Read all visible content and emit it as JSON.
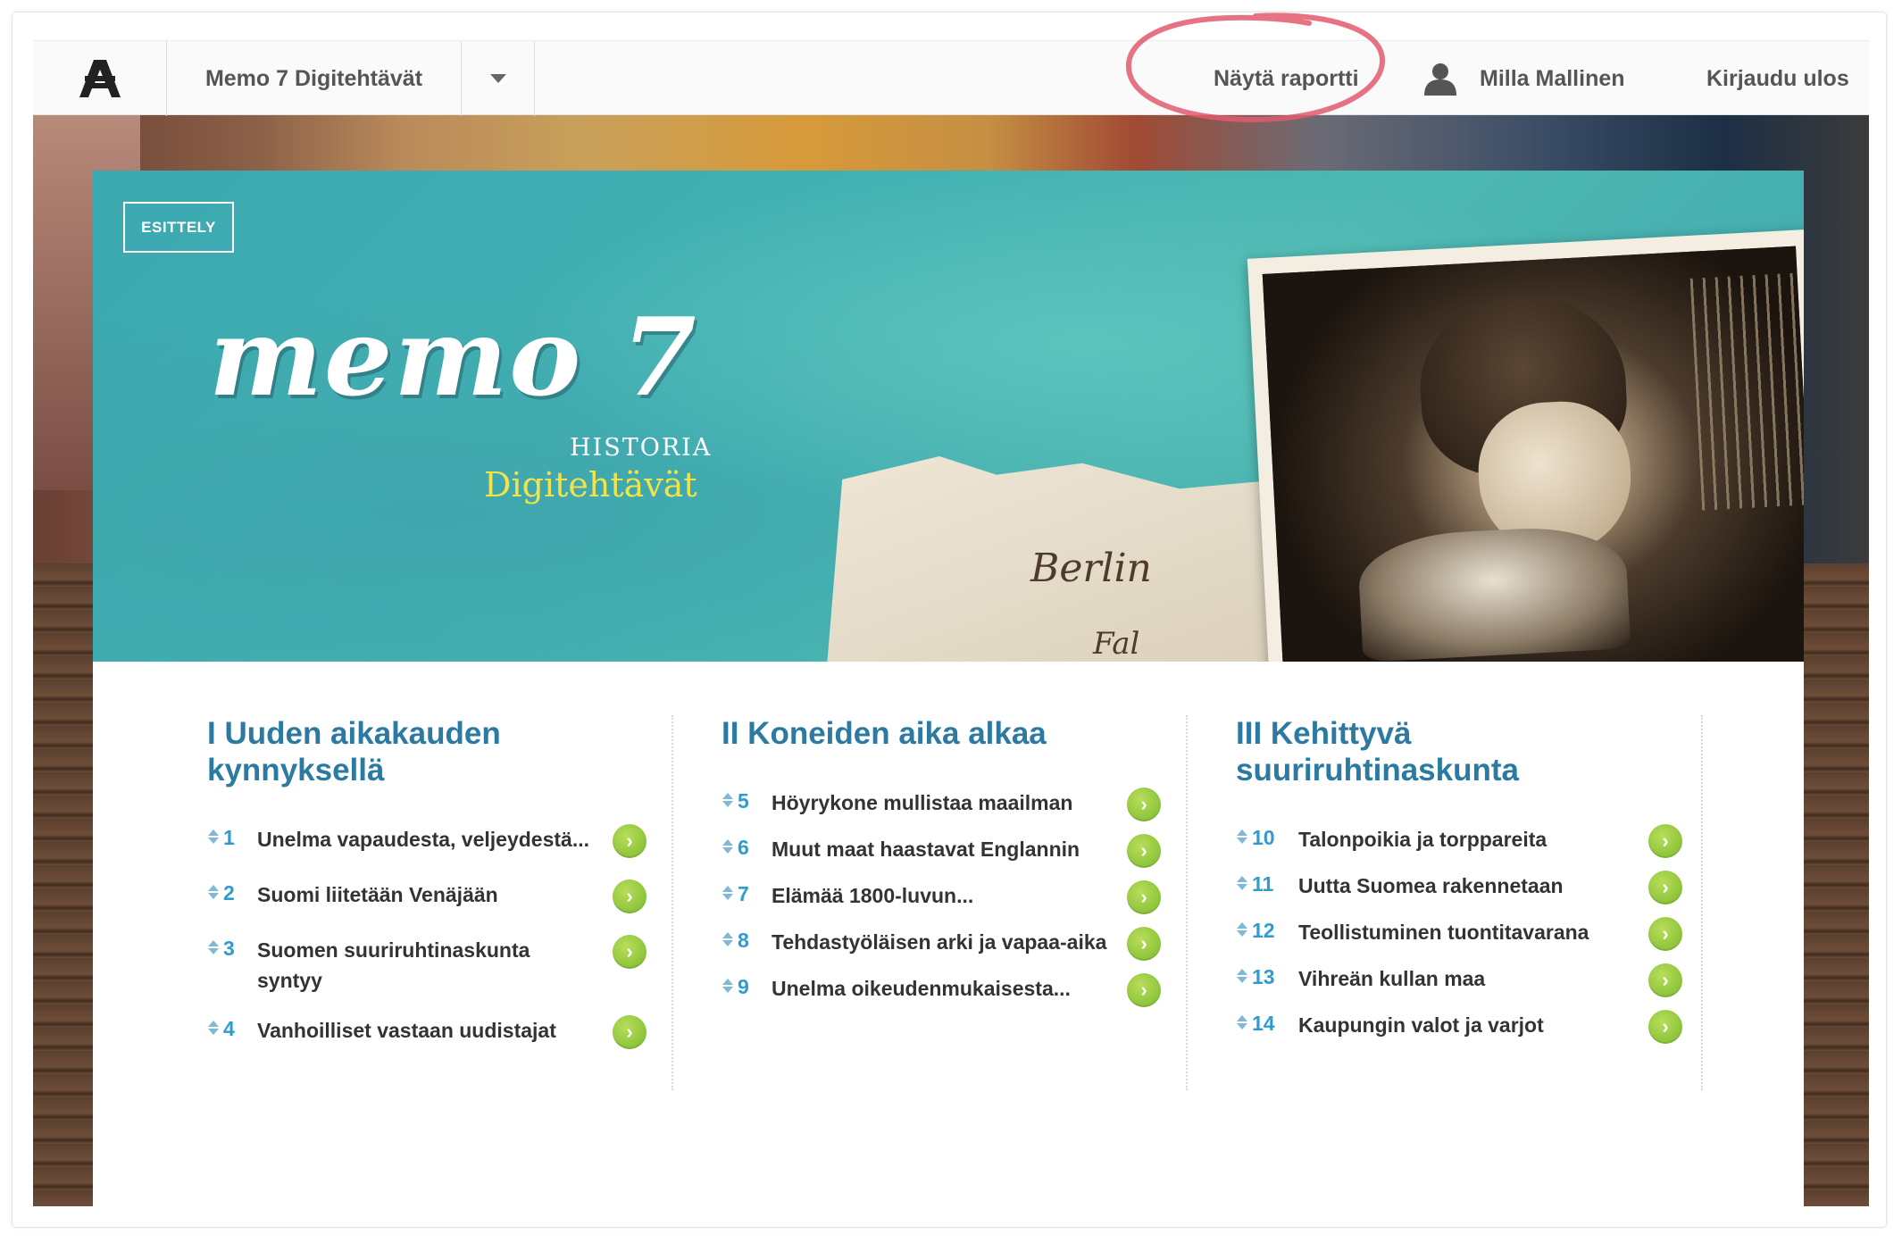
{
  "app": {
    "title": "Memo 7 Digitehtävät"
  },
  "nav": {
    "report_label": "Näytä raportti",
    "user_name": "Milla Mallinen",
    "logout_label": "Kirjaudu ulos"
  },
  "banner": {
    "badge": "ESITTELY",
    "logo_main": "memo 7",
    "logo_subject": "HISTORIA",
    "logo_product": "Digitehtävät",
    "paper_scribble_1": "Berlin",
    "paper_scribble_2": "Fal"
  },
  "chapters": [
    {
      "title": "I Uuden aikakauden kynnyksellä",
      "items": [
        {
          "num": "1",
          "label": "Unelma vapaudesta, veljeydestä..."
        },
        {
          "num": "2",
          "label": "Suomi liitetään Venäjään"
        },
        {
          "num": "3",
          "label": "Suomen suuriruhtinaskunta syntyy"
        },
        {
          "num": "4",
          "label": "Vanhoilliset vastaan uudistajat"
        }
      ]
    },
    {
      "title": "II Koneiden aika alkaa",
      "items": [
        {
          "num": "5",
          "label": "Höyrykone mullistaa maailman"
        },
        {
          "num": "6",
          "label": "Muut maat haastavat Englannin"
        },
        {
          "num": "7",
          "label": "Elämää 1800-luvun..."
        },
        {
          "num": "8",
          "label": "Tehdastyöläisen arki ja vapaa-aika"
        },
        {
          "num": "9",
          "label": "Unelma oikeudenmukaisesta..."
        }
      ]
    },
    {
      "title": "III Kehittyvä suuriruhtinaskunta",
      "items": [
        {
          "num": "10",
          "label": "Talonpoikia ja torppareita"
        },
        {
          "num": "11",
          "label": "Uutta Suomea rakennetaan"
        },
        {
          "num": "12",
          "label": "Teollistuminen tuontitavarana"
        },
        {
          "num": "13",
          "label": "Vihreän kullan maa"
        },
        {
          "num": "14",
          "label": "Kaupungin valot ja varjot"
        }
      ]
    }
  ],
  "icons": {
    "go_arrow": "›",
    "logo": "publisher-logo-icon",
    "user": "user-icon",
    "dropdown": "chevron-down-icon"
  },
  "colors": {
    "accent_blue": "#2c7aa1",
    "number_blue": "#2f9ccf",
    "go_green": "#8cc43a",
    "banner_teal": "#44b2b3",
    "highlight_red": "#e05a6e"
  }
}
